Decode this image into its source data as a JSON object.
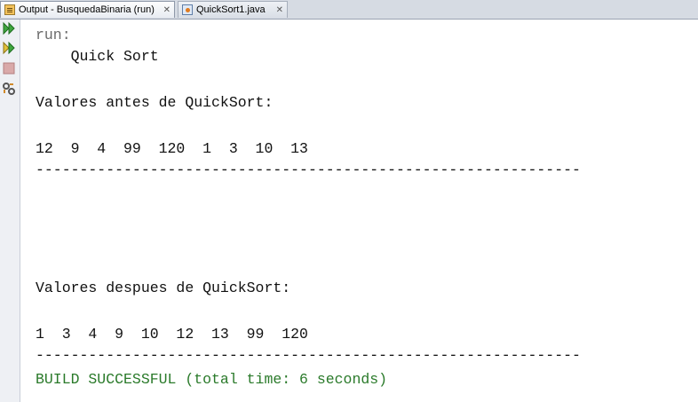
{
  "tabs": [
    {
      "label": "Output - BusquedaBinaria (run)",
      "close": "✕",
      "icon": "output-icon",
      "active": true
    },
    {
      "label": "QuickSort1.java",
      "close": "✕",
      "icon": "java-file-icon",
      "active": false
    }
  ],
  "toolbar": {
    "rerun_icon": "rerun-icon",
    "rerun_with_params_icon": "rerun-with-params-icon",
    "stop_icon": "stop-icon",
    "settings_icon": "settings-icon"
  },
  "console": {
    "run_line": "run:",
    "title": "    Quick Sort",
    "before_label": "Valores antes de QuickSort:",
    "before_values": "12  9  4  99  120  1  3  10  13",
    "separator1": "--------------------------------------------------------------",
    "after_label": "Valores despues de QuickSort:",
    "after_values": "1  3  4  9  10  12  13  99  120",
    "separator2": "--------------------------------------------------------------",
    "build_status": "BUILD SUCCESSFUL (total time: 6 seconds)"
  },
  "colors": {
    "run_text": "#6a6a6a",
    "output_text": "#111111",
    "success_text": "#2a7a2a",
    "background": "#ffffff"
  }
}
